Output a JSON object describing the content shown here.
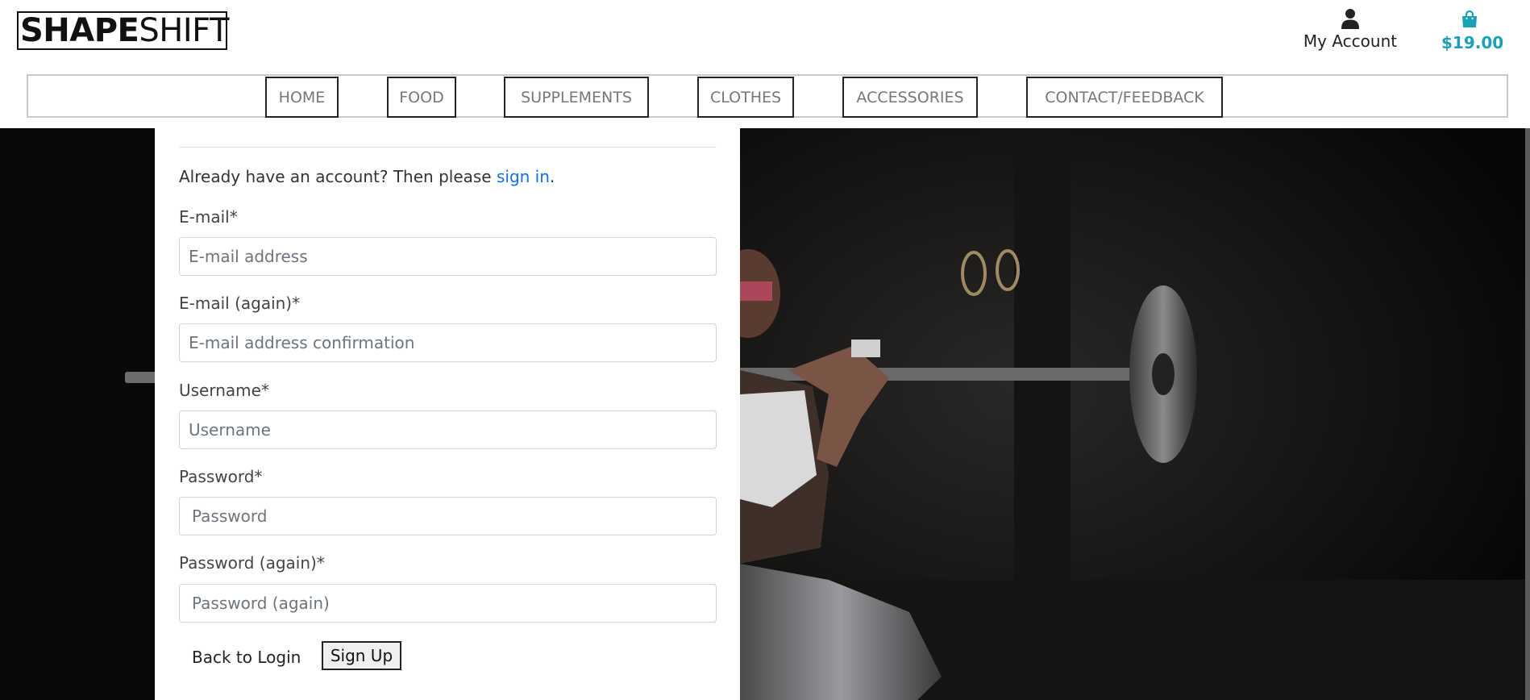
{
  "header": {
    "logo_bold": "SHAPE",
    "logo_light": "SHIFT",
    "account_label": "My Account",
    "cart_total": "$19.00"
  },
  "nav": {
    "items": [
      "HOME",
      "FOOD",
      "SUPPLEMENTS",
      "CLOTHES",
      "ACCESSORIES",
      "CONTACT/FEEDBACK"
    ]
  },
  "signup": {
    "intro_text": "Already have an account? Then please ",
    "sign_in_link": "sign in",
    "intro_end": ".",
    "email_label": "E-mail*",
    "email_placeholder": "E-mail address",
    "email2_label": "E-mail (again)*",
    "email2_placeholder": "E-mail address confirmation",
    "username_label": "Username*",
    "username_placeholder": "Username",
    "password_label": "Password*",
    "password_placeholder": "Password",
    "password2_label": "Password (again)*",
    "password2_placeholder": "Password (again)",
    "back_to_login": "Back to Login",
    "sign_up_button": "Sign Up"
  },
  "icons": {
    "account": "user-icon",
    "cart": "shopping-bag-icon"
  },
  "colors": {
    "link": "#0d6efd",
    "cart_accent": "#17a2b8",
    "hero_background": "#090909"
  }
}
